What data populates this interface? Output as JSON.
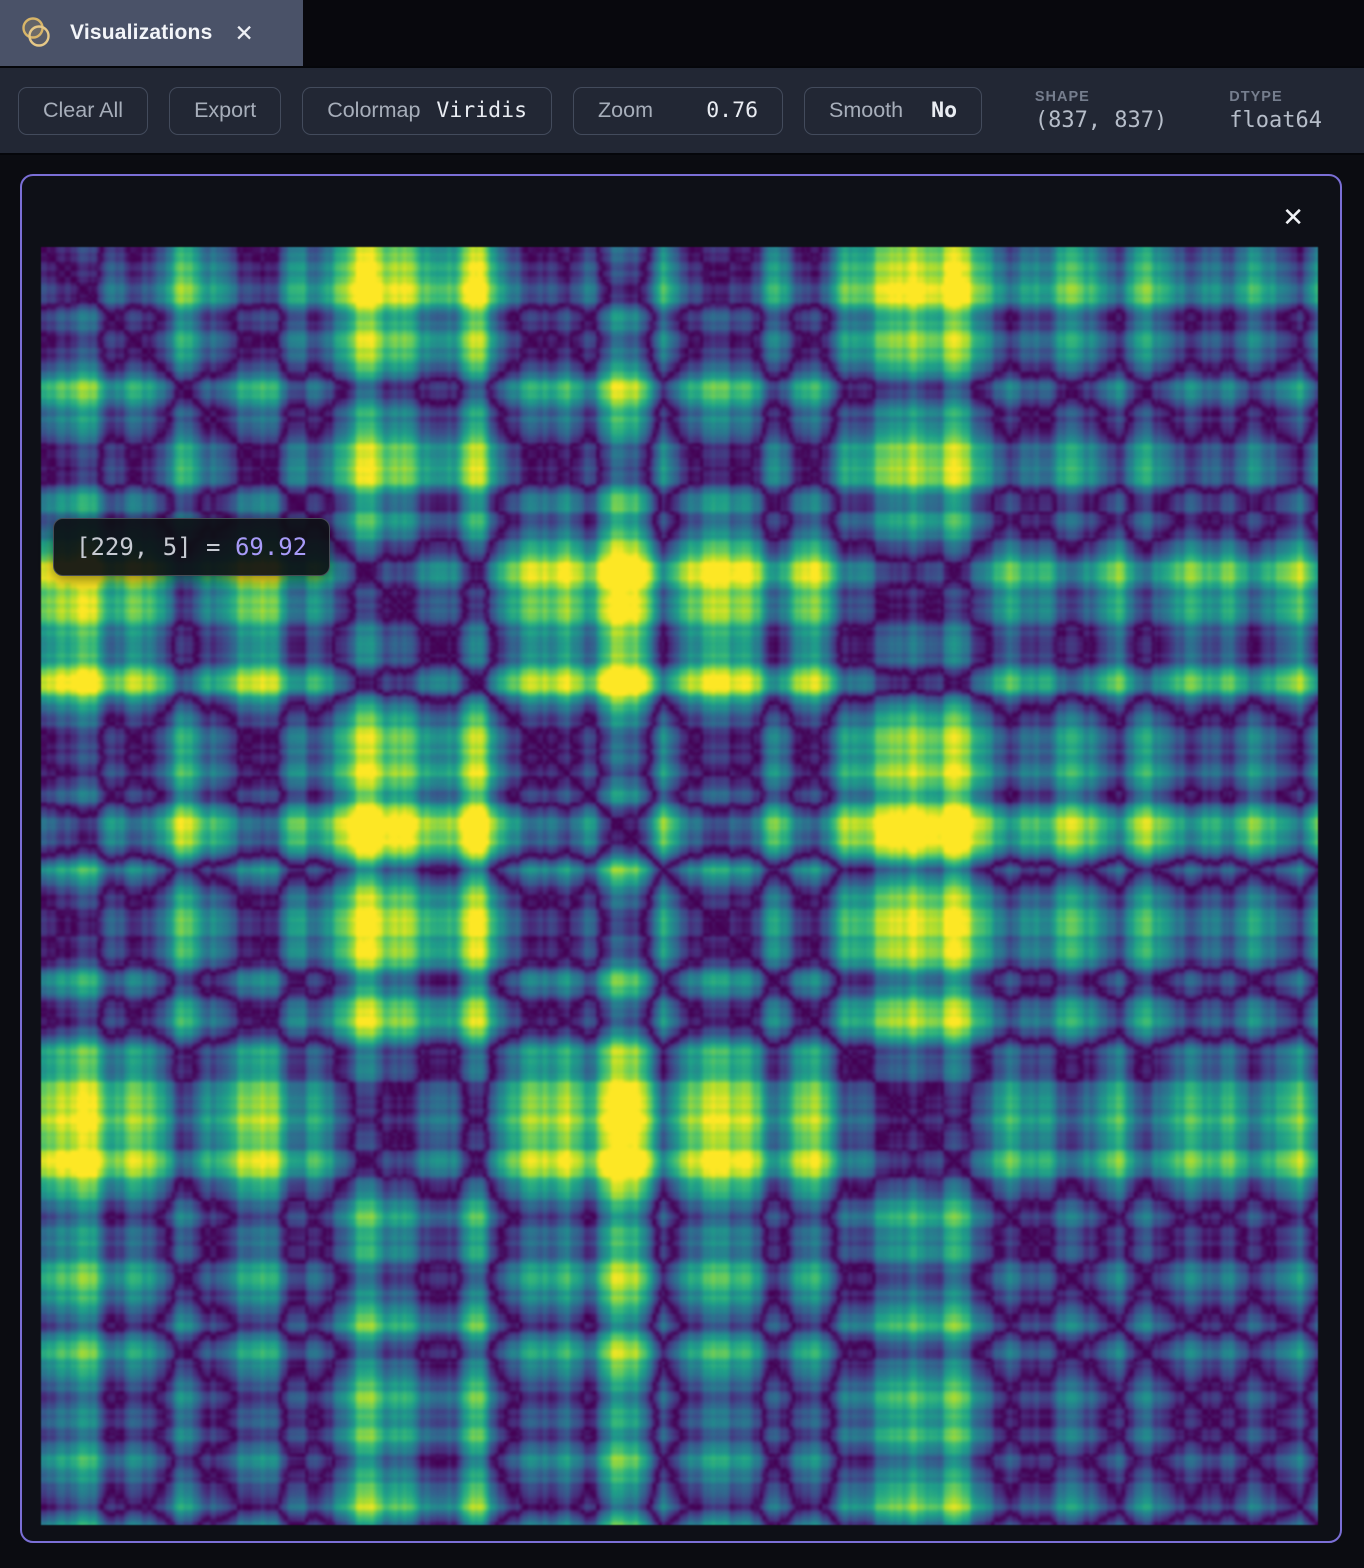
{
  "tab_bar": {
    "active_tab": {
      "label": "Visualizations"
    }
  },
  "icons": {
    "tab_close": "✕",
    "panel_close": "✕",
    "tab_icon_name": "venn-circles-icon"
  },
  "toolbar": {
    "clear_all_label": "Clear All",
    "export_label": "Export",
    "colormap": {
      "label": "Colormap",
      "value": "Viridis"
    },
    "zoom": {
      "label": "Zoom",
      "value": "0.76"
    },
    "smooth": {
      "label": "Smooth",
      "value": "No"
    },
    "shape": {
      "label": "SHAPE",
      "value": "(837, 837)"
    },
    "dtype": {
      "label": "DTYPE",
      "value": "float64"
    }
  },
  "viewer": {
    "tooltip": {
      "coords": "[229, 5] = ",
      "value": "69.92"
    }
  },
  "colors": {
    "panel_border": "#7b6fd6",
    "tab_active_bg": "#4a5268",
    "toolbar_bg": "#222734",
    "tooltip_value": "#a89bf8",
    "tab_icon_gold": "#d8b568"
  },
  "heatmap": {
    "type": "heatmap",
    "colormap": "viridis",
    "shape": [
      837,
      837
    ],
    "dtype": "float64",
    "zoom": 0.76,
    "smooth": false,
    "description": "symmetric pairwise-distance matrix with dark viridis-minimum diagonal, bright band near 45% index, bright last rows/cols",
    "generator": {
      "grid_n": 430,
      "norm": 0.74,
      "gamma": 0.95,
      "waves": [
        [
          1.0,
          2.3,
          0.8
        ],
        [
          0.75,
          5.1,
          2.1
        ],
        [
          0.6,
          8.7,
          4.4
        ],
        [
          0.45,
          13.3,
          1.0
        ],
        [
          0.35,
          21.1,
          3.3
        ],
        [
          0.22,
          34.7,
          5.6
        ],
        [
          0.1,
          71,
          1.2
        ],
        [
          0.07,
          113,
          4.0
        ],
        [
          0.05,
          167,
          2.5
        ]
      ],
      "peaks": [
        [
          2.3,
          0.452,
          0.013
        ],
        [
          1.1,
          0.475,
          0.008
        ],
        [
          -1.7,
          0.975,
          0.028
        ],
        [
          1.15,
          0.03,
          0.016
        ],
        [
          0.8,
          0.6,
          0.01
        ],
        [
          -0.9,
          0.745,
          0.014
        ],
        [
          0.7,
          0.215,
          0.012
        ],
        [
          -0.8,
          0.875,
          0.012
        ],
        [
          -0.6,
          0.335,
          0.01
        ]
      ],
      "viridis_stops": [
        [
          68,
          1,
          84
        ],
        [
          72,
          40,
          120
        ],
        [
          62,
          74,
          137
        ],
        [
          49,
          104,
          142
        ],
        [
          38,
          130,
          142
        ],
        [
          31,
          158,
          137
        ],
        [
          53,
          183,
          121
        ],
        [
          109,
          205,
          89
        ],
        [
          180,
          222,
          44
        ],
        [
          253,
          231,
          37
        ]
      ]
    }
  }
}
